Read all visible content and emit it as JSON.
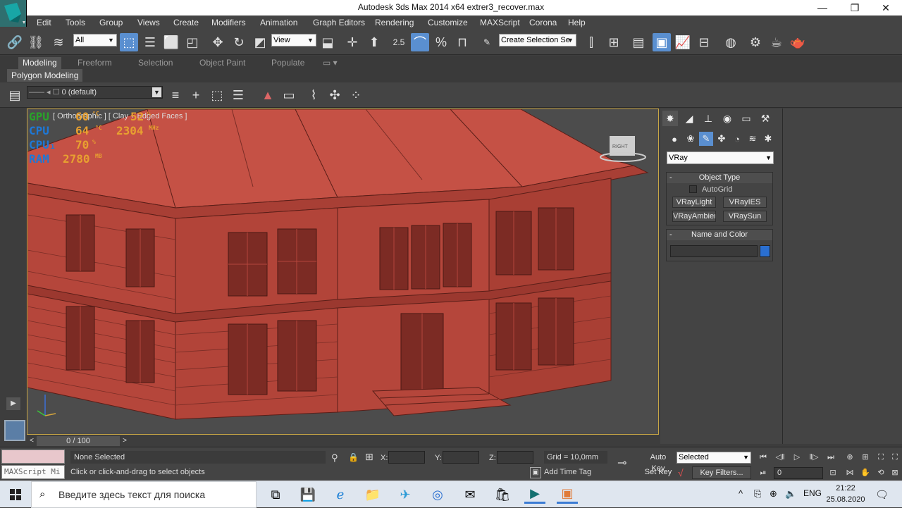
{
  "window": {
    "title": "Autodesk 3ds Max  2014 x64    extrer3_recover.max",
    "minimize": "—",
    "maximize": "❐",
    "close": "✕"
  },
  "menu": [
    "Edit",
    "Tools",
    "Group",
    "Views",
    "Create",
    "Modifiers",
    "Animation",
    "Graph Editors",
    "Rendering",
    "Customize",
    "MAXScript",
    "Corona",
    "Help"
  ],
  "toolbar": {
    "selection_filter": "All",
    "ref_coord": "View",
    "snap_value": "2.5",
    "angle_snap": "%",
    "named_selection": "Create Selection Se"
  },
  "ribbon": {
    "tabs": [
      "Modeling",
      "Freeform",
      "Selection",
      "Object Paint",
      "Populate"
    ],
    "active_tab": "Modeling",
    "panel": "Polygon Modeling"
  },
  "layer": {
    "current": "0 (default)"
  },
  "viewport": {
    "label": "[ Orthographic ] [ Clay + Edged Faces ]",
    "stats": {
      "gpu_label": "GPU",
      "gpu_temp": "60",
      "gpu_temp_unit": "°C",
      "gpu_load": "52",
      "gpu_load_unit": "%",
      "cpu_label": "CPU",
      "cpu_temp": "64",
      "cpu_temp_unit": "°C",
      "cpu_freq": "2304",
      "cpu_freq_unit": "MHz",
      "cpu1_label": "CPU₁",
      "cpu1_load": "70",
      "cpu1_load_unit": "%",
      "ram_label": "RAM",
      "ram_value": "2780",
      "ram_unit": "MB"
    },
    "viewcube_label": "RIGHT"
  },
  "command_panel": {
    "category": "VRay",
    "object_type_title": "Object Type",
    "autogrid": "AutoGrid",
    "buttons": [
      "VRayLight",
      "VRayIES",
      "VRayAmbientLight",
      "VRaySun"
    ],
    "name_color_title": "Name and Color",
    "color": "#2a6fd1"
  },
  "timeline": {
    "frame": "0 / 100"
  },
  "status": {
    "selection": "None Selected",
    "prompt": "Click or click-and-drag to select objects",
    "maxscript": "MAXScript Mi",
    "x_label": "X:",
    "y_label": "Y:",
    "z_label": "Z:",
    "grid": "Grid = 10,0mm",
    "add_time_tag": "Add Time Tag",
    "auto_key": "Auto Key",
    "set_key": "Set Key",
    "selected_dd": "Selected",
    "key_filters": "Key Filters...",
    "current_frame": "0"
  },
  "taskbar": {
    "search_placeholder": "Введите здесь текст для поиска",
    "lang": "ENG",
    "time": "21:22",
    "date": "25.08.2020"
  },
  "colors": {
    "building": "#b5463b",
    "building_dark": "#7a2d26",
    "roof": "#c55145",
    "viewport_bg": "#4c4c4c",
    "accent": "#5a8fd0"
  }
}
